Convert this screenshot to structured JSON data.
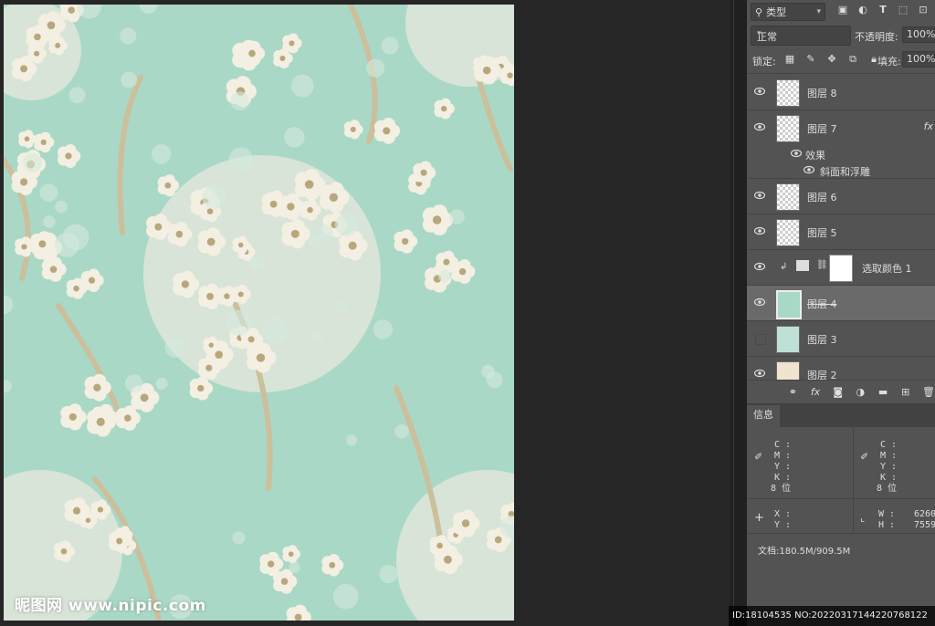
{
  "document": {
    "watermark": "昵图网 www.nipic.com",
    "colors": {
      "background": "#a9d8c6",
      "moon": "#dfe6d9",
      "blossom": "#f3efe2",
      "branch": "#cbbf9c"
    }
  },
  "layers_panel": {
    "filter_kind": "类型",
    "filter_icons": [
      "image-filter-icon",
      "adjustment-filter-icon",
      "type-filter-icon",
      "shape-filter-icon",
      "smart-object-filter-icon"
    ],
    "blend_mode": "正常",
    "opacity_label": "不透明度:",
    "opacity_value": "100%",
    "lock_label": "锁定:",
    "fill_label": "填充:",
    "fill_value": "100%",
    "layers": [
      {
        "name": "图层 8",
        "visible": true
      },
      {
        "name": "图层 7",
        "visible": true,
        "fx": "fx"
      },
      {
        "name": "图层 6",
        "visible": true
      },
      {
        "name": "图层 5",
        "visible": true
      },
      {
        "name": "选取颜色 1",
        "visible": true
      },
      {
        "name": "图层 4",
        "visible": true,
        "selected": true
      },
      {
        "name": "图层 3",
        "visible": false
      },
      {
        "name": "图层 2",
        "visible": true
      }
    ],
    "effects_label": "效果",
    "effect_name": "斜面和浮雕"
  },
  "info_panel": {
    "tab": "信息",
    "left_cmyk": [
      "C :",
      "M :",
      "Y :",
      "K :",
      "8 位"
    ],
    "right_cmyk": [
      "C :",
      "M :",
      "Y :",
      "K :",
      "8 位"
    ],
    "xy": [
      "X :",
      "Y :"
    ],
    "wh": [
      "W :",
      "H :"
    ],
    "w_value": "6260",
    "h_value": "7559",
    "doc_size": "文档:180.5M/909.5M"
  },
  "id_bar": "ID:18104535 NO:20220317144220768122"
}
